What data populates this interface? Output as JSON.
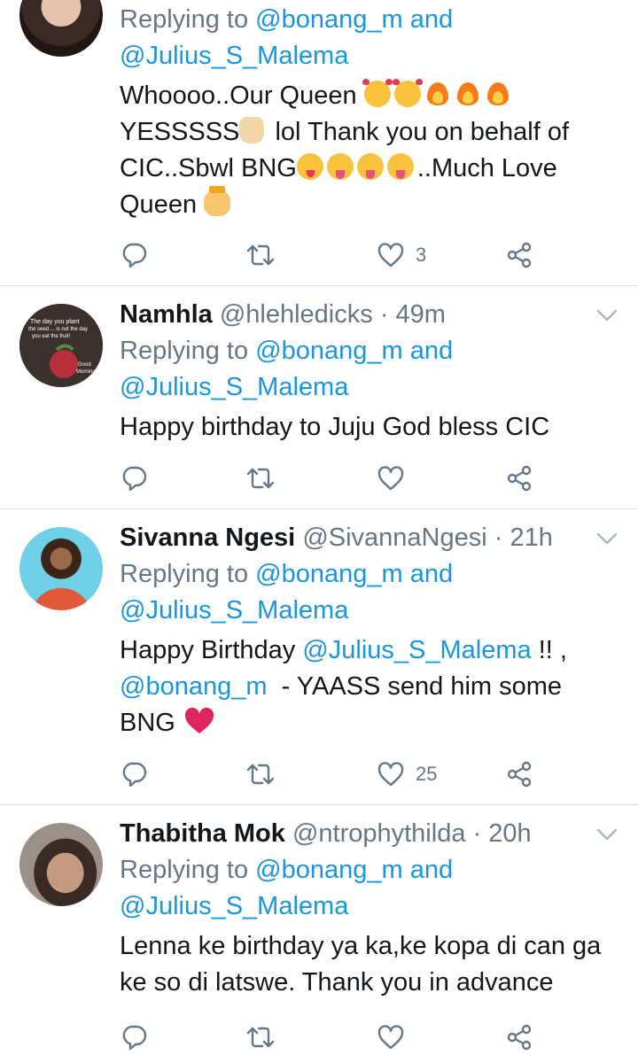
{
  "tweets": [
    {
      "name": "",
      "handle": "",
      "time": "",
      "replying_prefix": "Replying to",
      "replying_user1": "@bonang_m",
      "replying_and": "and",
      "replying_user2": "@Julius_S_Malema",
      "text_line1": "Whoooo..Our Queen",
      "text_line2": "YESSSSS",
      "text_line2b": " lol Thank you on behalf of",
      "text_line3": "CIC..Sbwl BNG",
      "text_line3b": "..Much Love",
      "text_line4": "Queen",
      "like_count": "3"
    },
    {
      "name": "Namhla",
      "handle": "@hlehledicks",
      "time": "· 49m",
      "replying_prefix": "Replying to",
      "replying_user1": "@bonang_m",
      "replying_and": "and",
      "replying_user2": "@Julius_S_Malema",
      "avatar_text1": "The day you plant",
      "avatar_text2": "the seed ... is not the day",
      "avatar_text3": "you eat the fruit!",
      "avatar_text4": "Good",
      "avatar_text5": "Morning",
      "text_line1": "Happy birthday to Juju God bless CIC",
      "like_count": ""
    },
    {
      "name": "Sivanna Ngesi",
      "handle": "@SivannaNgesi",
      "time": "· 21h",
      "replying_prefix": "Replying to",
      "replying_user1": "@bonang_m",
      "replying_and": "and",
      "replying_user2": "@Julius_S_Malema",
      "text_line1a": "Happy Birthday ",
      "text_line1_mention": "@Julius_S_Malema",
      "text_line1b": " !! ,",
      "text_line2_mention": "@bonang_m",
      "text_line2b": "  - YAASS send him some",
      "text_line3": "BNG",
      "like_count": "25"
    },
    {
      "name": "Thabitha Mok",
      "handle": "@ntrophythilda",
      "time": "· 20h",
      "replying_prefix": "Replying to",
      "replying_user1": "@bonang_m",
      "replying_and": "and",
      "replying_user2": "@Julius_S_Malema",
      "text_line1": "Lenna ke birthday ya ka,ke kopa di can ga",
      "text_line2": "ke so di latswe. Thank you in advance",
      "like_count": ""
    }
  ],
  "colors": {
    "link": "#1b95e0",
    "gray": "#657786",
    "heart": "#e0245e",
    "divider": "#dde2e6"
  },
  "icons": [
    "reply-icon",
    "retweet-icon",
    "like-icon",
    "share-icon",
    "chevron-down-icon"
  ]
}
